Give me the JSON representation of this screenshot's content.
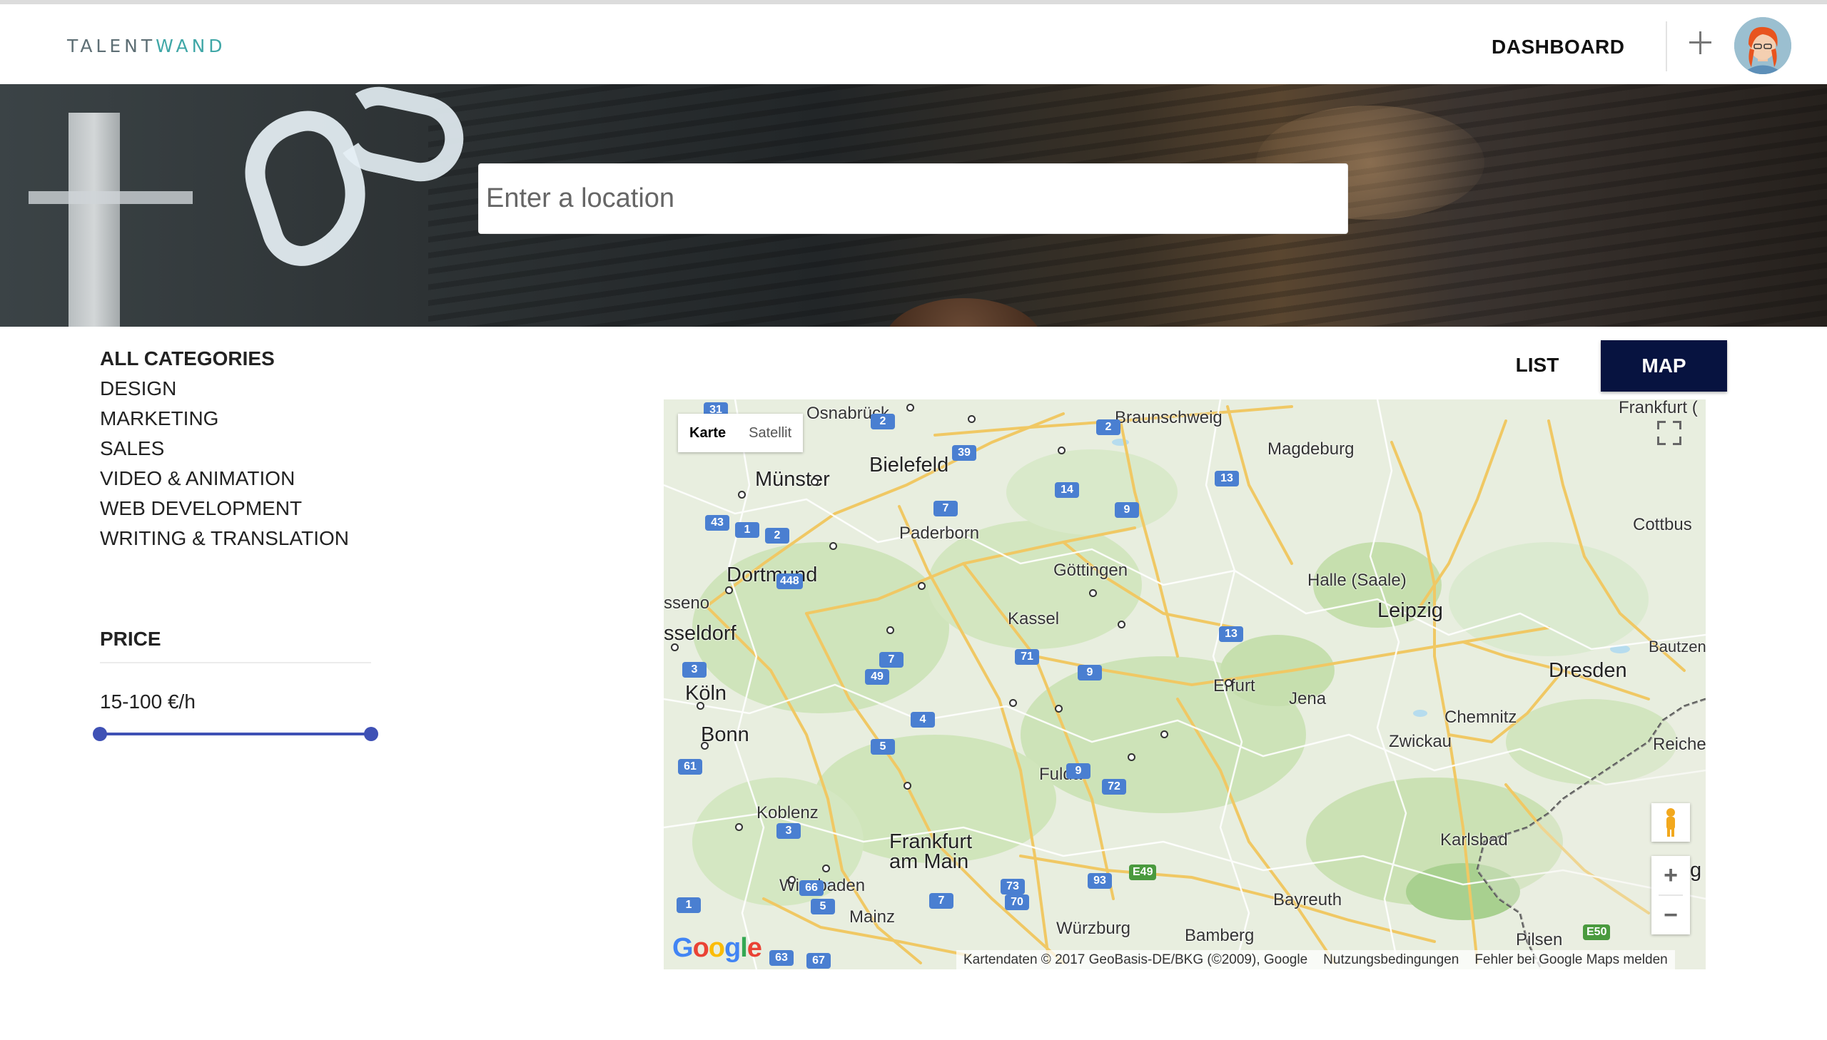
{
  "header": {
    "logo_part1": "TALENT",
    "logo_part2": "WAND",
    "dashboard_label": "DASHBOARD",
    "plus_icon": "plus-icon",
    "avatar_icon": "user-avatar"
  },
  "hero": {
    "search_placeholder": "Enter a location",
    "search_value": ""
  },
  "sidebar": {
    "categories": [
      "ALL CATEGORIES",
      "DESIGN",
      "MARKETING",
      "SALES",
      "VIDEO & ANIMATION",
      "WEB DEVELOPMENT",
      "WRITING & TRANSLATION"
    ],
    "active_category": "ALL CATEGORIES",
    "price_title": "PRICE",
    "price_value": "15-100 €/h",
    "price_range": {
      "min": 15,
      "max": 100,
      "unit": "€/h"
    }
  },
  "view_toggle": {
    "list_label": "LIST",
    "map_label": "MAP",
    "selected": "MAP",
    "accent_color": "#071340"
  },
  "map": {
    "type_options": [
      "Karte",
      "Satellit"
    ],
    "selected_type": "Karte",
    "labels_big": [
      "Münster",
      "Bielefeld",
      "Dortmund",
      "Leipzig",
      "Dresden",
      "Köln",
      "Bonn",
      "Frankfurt",
      "am Main"
    ],
    "labels_mid": [
      "Osnabrück",
      "Braunschweig",
      "Magdeburg",
      "Frankfurt (",
      "Paderborn",
      "Cottbus",
      "Göttingen",
      "Halle (Saale)",
      "Kassel",
      "Erfurt",
      "Jena",
      "Chemnitz",
      "Zwickau",
      "Fulda",
      "Koblenz",
      "Wiesbaden",
      "Mainz",
      "Karlsbad",
      "Bayreuth",
      "Würzburg",
      "Bamberg",
      "Pilsen",
      "Bautzen",
      "Reiche",
      "sseno",
      "sseldorf"
    ],
    "shields": [
      "31",
      "2",
      "39",
      "2",
      "7",
      "14",
      "13",
      "43",
      "1",
      "2",
      "448",
      "9",
      "13",
      "71",
      "7",
      "49",
      "9",
      "3",
      "4",
      "5",
      "9",
      "61",
      "72",
      "3",
      "73",
      "93",
      "E49",
      "1",
      "66",
      "5",
      "70",
      "7",
      "E50",
      "63",
      "67"
    ],
    "google_logo": "Google",
    "attribution": "Kartendaten © 2017 GeoBasis-DE/BKG (©2009), Google",
    "terms": "Nutzungsbedingungen",
    "report": "Fehler bei Google Maps melden",
    "zoom_in": "+",
    "zoom_out": "−",
    "cut_letter": "g"
  }
}
